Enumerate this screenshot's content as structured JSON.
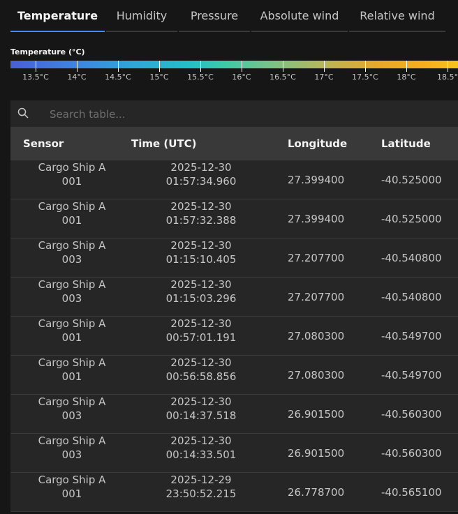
{
  "tabs": [
    {
      "label": "Temperature",
      "active": true
    },
    {
      "label": "Humidity",
      "active": false
    },
    {
      "label": "Pressure",
      "active": false
    },
    {
      "label": "Absolute wind",
      "active": false
    },
    {
      "label": "Relative wind",
      "active": false
    }
  ],
  "scale": {
    "title": "Temperature (°C)",
    "ticks": [
      "13.5°C",
      "14°C",
      "14.5°C",
      "15°C",
      "15.5°C",
      "16°C",
      "16.5°C",
      "17°C",
      "17.5°C",
      "18°C",
      "18.5°"
    ]
  },
  "search": {
    "placeholder": "Search table..."
  },
  "table": {
    "headers": {
      "sensor": "Sensor",
      "time": "Time (UTC)",
      "longitude": "Longitude",
      "latitude": "Latitude"
    },
    "rows": [
      {
        "sensor_line1": "Cargo Ship A",
        "sensor_line2": "001",
        "date": "2025-12-30",
        "time": "01:57:34.960",
        "longitude": "27.399400",
        "latitude": "-40.525000"
      },
      {
        "sensor_line1": "Cargo Ship A",
        "sensor_line2": "001",
        "date": "2025-12-30",
        "time": "01:57:32.388",
        "longitude": "27.399400",
        "latitude": "-40.525000"
      },
      {
        "sensor_line1": "Cargo Ship A",
        "sensor_line2": "003",
        "date": "2025-12-30",
        "time": "01:15:10.405",
        "longitude": "27.207700",
        "latitude": "-40.540800"
      },
      {
        "sensor_line1": "Cargo Ship A",
        "sensor_line2": "003",
        "date": "2025-12-30",
        "time": "01:15:03.296",
        "longitude": "27.207700",
        "latitude": "-40.540800"
      },
      {
        "sensor_line1": "Cargo Ship A",
        "sensor_line2": "001",
        "date": "2025-12-30",
        "time": "00:57:01.191",
        "longitude": "27.080300",
        "latitude": "-40.549700"
      },
      {
        "sensor_line1": "Cargo Ship A",
        "sensor_line2": "001",
        "date": "2025-12-30",
        "time": "00:56:58.856",
        "longitude": "27.080300",
        "latitude": "-40.549700"
      },
      {
        "sensor_line1": "Cargo Ship A",
        "sensor_line2": "003",
        "date": "2025-12-30",
        "time": "00:14:37.518",
        "longitude": "26.901500",
        "latitude": "-40.560300"
      },
      {
        "sensor_line1": "Cargo Ship A",
        "sensor_line2": "003",
        "date": "2025-12-30",
        "time": "00:14:33.501",
        "longitude": "26.901500",
        "latitude": "-40.560300"
      },
      {
        "sensor_line1": "Cargo Ship A",
        "sensor_line2": "001",
        "date": "2025-12-29",
        "time": "23:50:52.215",
        "longitude": "26.778700",
        "latitude": "-40.565100"
      }
    ]
  },
  "colors": {
    "accent": "#4589ff",
    "background": "#161616",
    "row": "#262626",
    "header": "#393939"
  }
}
